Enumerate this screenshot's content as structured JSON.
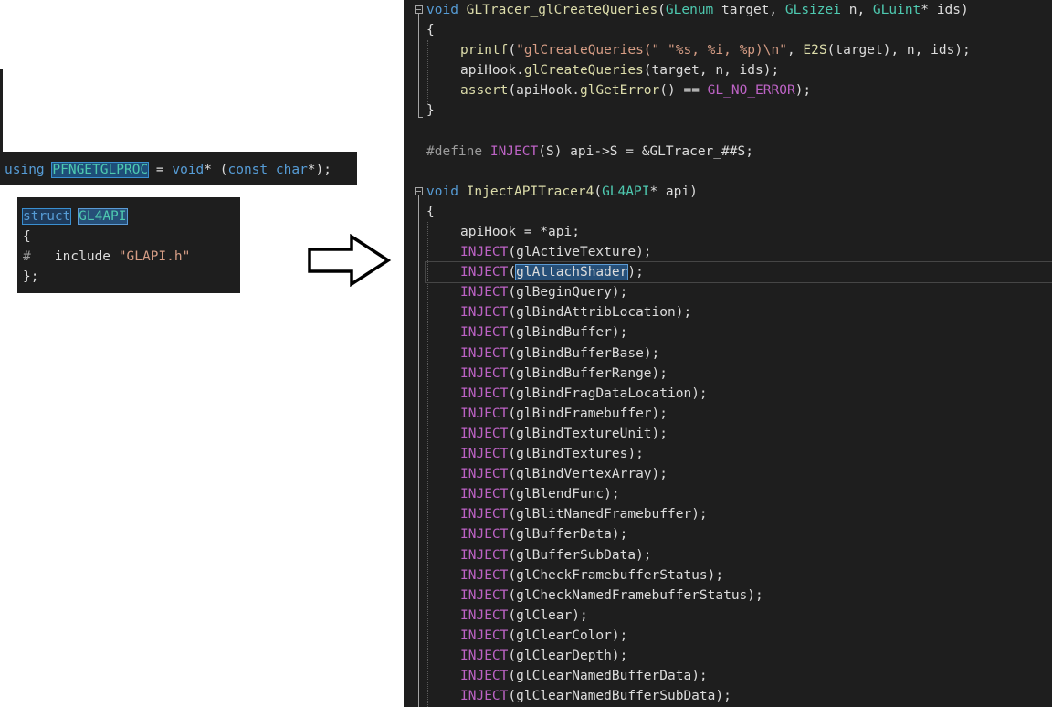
{
  "left": {
    "using": {
      "kw_using": "using",
      "alias": "PFNGETGLPROC",
      "rest_a": " = ",
      "kw_void": "void",
      "rest_b": "* (",
      "kw_const": "const",
      "rest_c": " ",
      "kw_char": "char",
      "rest_d": "*);"
    },
    "struct": {
      "kw_struct": "struct",
      "name": "GL4API",
      "open_brace": "{",
      "hash": "#",
      "include_kw": "   include ",
      "include_file": "\"GLAPI.h\"",
      "close": "};"
    }
  },
  "arrow": {
    "icon": "right-arrow-icon"
  },
  "editor": {
    "fn1": {
      "kw_void": "void",
      "name": "GLTracer_glCreateQueries",
      "params_a": "(",
      "t1": "GLenum",
      "params_b": " target, ",
      "t2": "GLsizei",
      "params_c": " n, ",
      "t3": "GLuint",
      "params_d": "* ids)",
      "open": "{",
      "printf_name": "printf",
      "printf_a": "(",
      "printf_s1": "\"glCreateQueries(\"",
      "printf_b": " ",
      "printf_s2": "\"%s, %i, %p)\\n\"",
      "printf_c": ", ",
      "printf_fn": "E2S",
      "printf_d": "(target), n, ids);",
      "hook_a": "apiHook.",
      "hook_fn": "glCreateQueries",
      "hook_b": "(target, n, ids);",
      "assert_fn": "assert",
      "assert_a": "(apiHook.",
      "assert_fn2": "glGetError",
      "assert_b": "() == ",
      "assert_mac": "GL_NO_ERROR",
      "assert_c": ");",
      "close": "}"
    },
    "define": {
      "directive": "#define",
      "macro": "INJECT",
      "body_a": "(S) api->S = &GLTracer_##S;"
    },
    "fn2": {
      "kw_void": "void",
      "name": "InjectAPITracer4",
      "params_a": "(",
      "t1": "GL4API",
      "params_b": "* api)",
      "open": "{",
      "assign": "apiHook = *api;"
    },
    "inject_macro": "INJECT",
    "highlighted_index": 1,
    "injects": [
      "glActiveTexture",
      "glAttachShader",
      "glBeginQuery",
      "glBindAttribLocation",
      "glBindBuffer",
      "glBindBufferBase",
      "glBindBufferRange",
      "glBindFragDataLocation",
      "glBindFramebuffer",
      "glBindTextureUnit",
      "glBindTextures",
      "glBindVertexArray",
      "glBlendFunc",
      "glBlitNamedFramebuffer",
      "glBufferData",
      "glBufferSubData",
      "glCheckFramebufferStatus",
      "glCheckNamedFramebufferStatus",
      "glClear",
      "glClearColor",
      "glClearDepth",
      "glClearNamedBufferData",
      "glClearNamedBufferSubData"
    ]
  },
  "colors": {
    "editor_bg": "#1e1e1e",
    "keyword": "#569cd6",
    "type": "#4ec9b0",
    "function": "#dcdcaa",
    "string": "#d69d85",
    "macro": "#bd63c5",
    "selection": "#264f78"
  }
}
